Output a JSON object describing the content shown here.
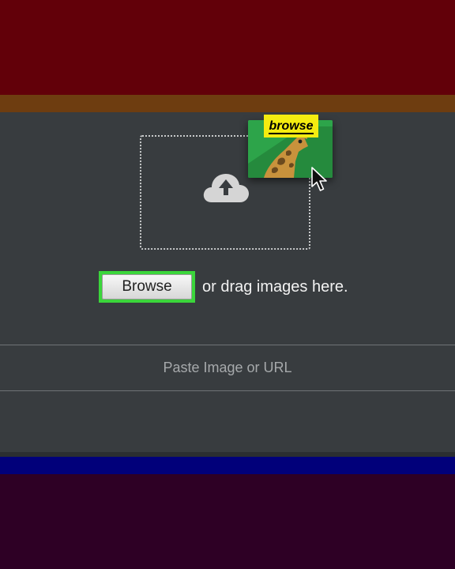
{
  "upload": {
    "browse_button_label": "Browse",
    "drag_hint": "or drag images here.",
    "paste_placeholder": "Paste Image or URL"
  },
  "annotation": {
    "tag_label": "browse"
  },
  "colors": {
    "top_band": "#620009",
    "orange_band": "#6e3d10",
    "panel_background": "#383c3f",
    "blue_band": "#01007a",
    "bottom_band": "#2e0025",
    "highlight_green": "#3bd63b",
    "tag_yellow": "#f4ec10",
    "thumbnail_green": "#2da44a"
  },
  "icons": {
    "upload": "cloud-upload-icon",
    "thumbnail": "giraffe-image-icon",
    "pointer": "mouse-cursor-icon"
  }
}
